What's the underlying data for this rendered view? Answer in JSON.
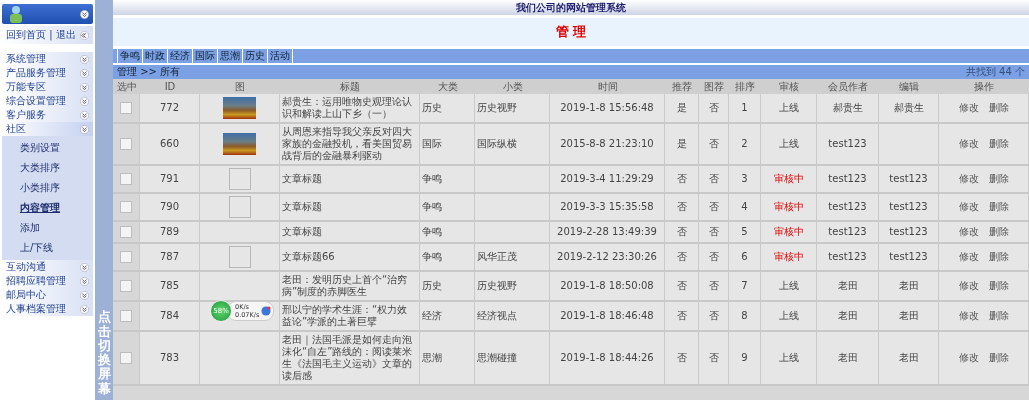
{
  "sidebar": {
    "home_link": "回到首页",
    "separator": "|",
    "logout_link": "退出",
    "menu": [
      {
        "label": "系统管理"
      },
      {
        "label": "产品服务管理"
      },
      {
        "label": "万能专区"
      },
      {
        "label": "综合设置管理"
      },
      {
        "label": "客户服务"
      },
      {
        "label": "社区",
        "expanded": true,
        "children": [
          {
            "label": "类别设置",
            "selected": false
          },
          {
            "label": "大类排序",
            "selected": false
          },
          {
            "label": "小类排序",
            "selected": false
          },
          {
            "label": "内容管理",
            "selected": true
          },
          {
            "label": "添加",
            "selected": false
          },
          {
            "label": "上/下线",
            "selected": false
          }
        ]
      },
      {
        "label": "互动沟通"
      },
      {
        "label": "招聘应聘管理"
      },
      {
        "label": "邮局中心"
      },
      {
        "label": "人事档案管理"
      }
    ]
  },
  "toggle_strip": "点击切换屏幕",
  "window": {
    "title": "我们公司的网站管理系统"
  },
  "page_title": "管 理",
  "category_tabs": [
    "争鸣",
    "时政",
    "经济",
    "国际",
    "思潮",
    "历史",
    "活动"
  ],
  "breadcrumb": "管理 >> 所有",
  "result_count": "共找到 44 个",
  "table": {
    "columns": [
      "选中",
      "ID",
      "图",
      "标题",
      "大类",
      "小类",
      "时间",
      "推荐",
      "图荐",
      "排序",
      "审核",
      "会员作者",
      "编辑",
      "操作"
    ],
    "rows": [
      {
        "checked": false,
        "id": "772",
        "kind": "photo",
        "title": "郝贵生：运用唯物史观理论认识和解读上山下乡（一）",
        "category": "历史",
        "subcategory": "历史视野",
        "time": "2019-1-8 15:56:48",
        "recommend": "是",
        "image_recommend": "否",
        "order": "1",
        "status": "上线",
        "pending": false,
        "author": "郝贵生",
        "editor": "郝贵生",
        "actions": [
          "修改",
          "删除"
        ]
      },
      {
        "checked": false,
        "id": "660",
        "kind": "photo",
        "title": "从周恩来指导我父亲反对四大家族的金融投机，看美国贸易战背后的金融暴利驱动",
        "category": "国际",
        "subcategory": "国际纵横",
        "time": "2015-8-8 21:23:10",
        "recommend": "是",
        "image_recommend": "否",
        "order": "2",
        "status": "上线",
        "pending": false,
        "author": "test123",
        "actions": [
          "修改",
          "删除"
        ]
      },
      {
        "checked": false,
        "id": "791",
        "kind": "broken",
        "title": "文章标题",
        "category": "争鸣",
        "time": "2019-3-4 11:29:29",
        "recommend": "否",
        "image_recommend": "否",
        "order": "3",
        "status": "审核中",
        "pending": true,
        "author": "test123",
        "editor": "test123",
        "actions": [
          "修改",
          "删除"
        ]
      },
      {
        "checked": false,
        "id": "790",
        "kind": "broken",
        "title": "文章标题",
        "category": "争鸣",
        "time": "2019-3-3 15:35:58",
        "recommend": "否",
        "image_recommend": "否",
        "order": "4",
        "status": "审核中",
        "pending": true,
        "author": "test123",
        "editor": "test123",
        "actions": [
          "修改",
          "删除"
        ]
      },
      {
        "checked": false,
        "id": "789",
        "kind": "plain",
        "title": "文章标题",
        "category": "争鸣",
        "time": "2019-2-28 13:49:39",
        "recommend": "否",
        "image_recommend": "否",
        "order": "5",
        "status": "审核中",
        "pending": true,
        "author": "test123",
        "editor": "test123",
        "actions": [
          "修改",
          "删除"
        ]
      },
      {
        "checked": false,
        "id": "787",
        "kind": "broken",
        "title": "文章标题66",
        "category": "争鸣",
        "subcategory": "风华正茂",
        "time": "2019-2-12 23:30:26",
        "recommend": "否",
        "image_recommend": "否",
        "order": "6",
        "status": "审核中",
        "pending": true,
        "author": "test123",
        "editor": "test123",
        "actions": [
          "修改",
          "删除"
        ]
      },
      {
        "checked": false,
        "id": "785",
        "kind": "plain",
        "title": "老田：发明历史上首个“治穷病”制度的赤脚医生",
        "category": "历史",
        "subcategory": "历史视野",
        "time": "2019-1-8 18:50:08",
        "recommend": "否",
        "image_recommend": "否",
        "order": "7",
        "status": "上线",
        "pending": false,
        "author": "老田",
        "editor": "老田",
        "actions": [
          "修改",
          "删除"
        ]
      },
      {
        "checked": false,
        "id": "784",
        "kind": "plain",
        "title": "邢以宁的学术生涯：“权力效益论”学派的土著巨擘",
        "category": "经济",
        "subcategory": "经济视点",
        "time": "2019-1-8 18:46:48",
        "recommend": "否",
        "image_recommend": "否",
        "order": "8",
        "status": "上线",
        "pending": false,
        "author": "老田",
        "editor": "老田",
        "actions": [
          "修改",
          "删除"
        ]
      },
      {
        "checked": false,
        "id": "783",
        "kind": "plain",
        "title": "老田｜法国毛派是如何走向泡沫化“自左”路线的：阅读莱米生《法国毛主义运动》文章的读后感",
        "category": "思潮",
        "subcategory": "思潮碰撞",
        "time": "2019-1-8 18:44:26",
        "recommend": "否",
        "image_recommend": "否",
        "order": "9",
        "status": "上线",
        "pending": false,
        "author": "老田",
        "editor": "老田",
        "actions": [
          "修改",
          "删除"
        ]
      }
    ]
  },
  "speed_widget": {
    "percent": "58%",
    "upload": "0K/s",
    "download": "0.07K/s"
  }
}
